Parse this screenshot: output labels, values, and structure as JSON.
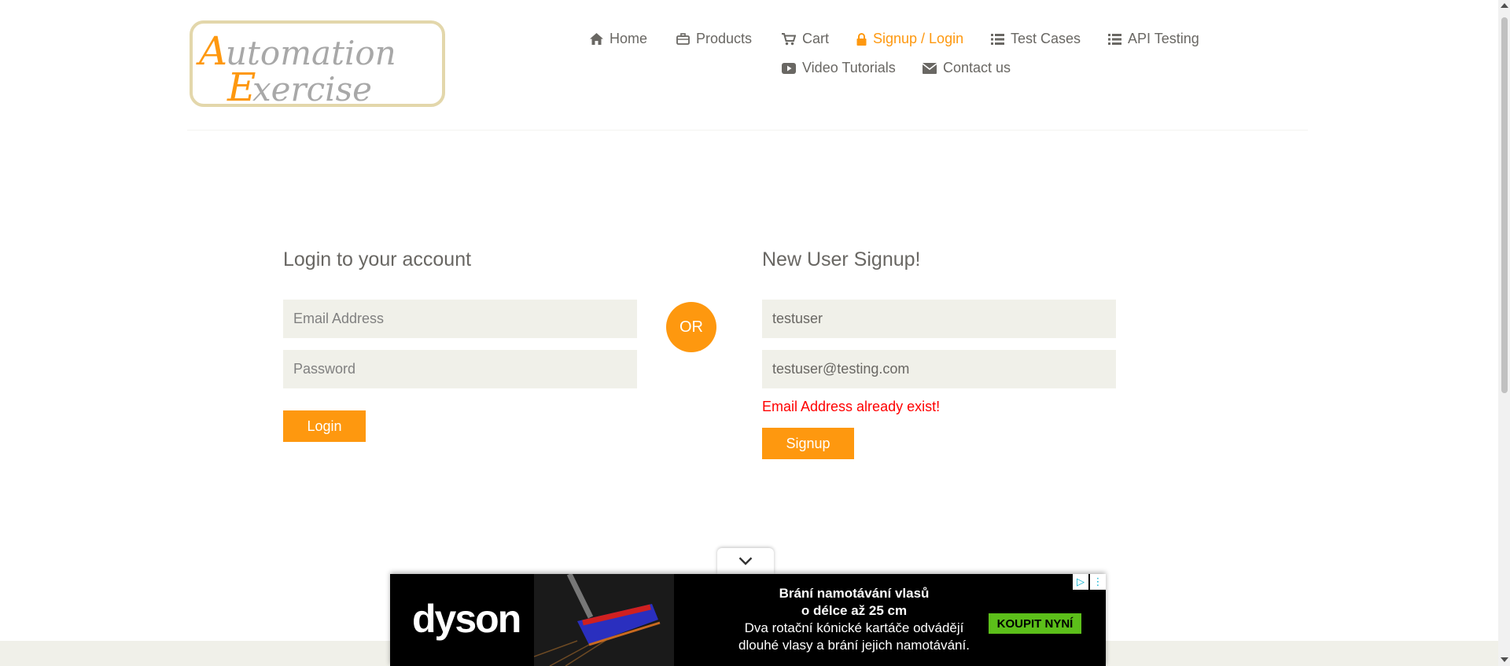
{
  "logo": {
    "text_line1": "Automation",
    "text_line2": "Exercise"
  },
  "nav": {
    "items": [
      {
        "label": "Home",
        "icon": "home-icon"
      },
      {
        "label": "Products",
        "icon": "briefcase-icon"
      },
      {
        "label": "Cart",
        "icon": "cart-icon"
      },
      {
        "label": "Signup / Login",
        "icon": "lock-icon",
        "active": true
      },
      {
        "label": "Test Cases",
        "icon": "list-icon"
      },
      {
        "label": "API Testing",
        "icon": "list-icon"
      },
      {
        "label": "Video Tutorials",
        "icon": "youtube-icon"
      },
      {
        "label": "Contact us",
        "icon": "envelope-icon"
      }
    ]
  },
  "login": {
    "title": "Login to your account",
    "email_placeholder": "Email Address",
    "password_placeholder": "Password",
    "button": "Login"
  },
  "or_label": "OR",
  "signup": {
    "title": "New User Signup!",
    "name_value": "testuser",
    "email_value": "testuser@testing.com",
    "error": "Email Address already exist!",
    "button": "Signup"
  },
  "ad": {
    "brand": "dyson",
    "line1": "Brání namotávání vlasů",
    "line2": "o délce až 25 cm",
    "line3": "Dva rotační kónické kartáče odvádějí",
    "line4": "dlouhé vlasy a brání jejich namotávání.",
    "cta": "KOUPIT NYNÍ"
  },
  "colors": {
    "accent": "#FE980F",
    "error": "#ff0000",
    "field_bg": "#f0f0e9"
  }
}
